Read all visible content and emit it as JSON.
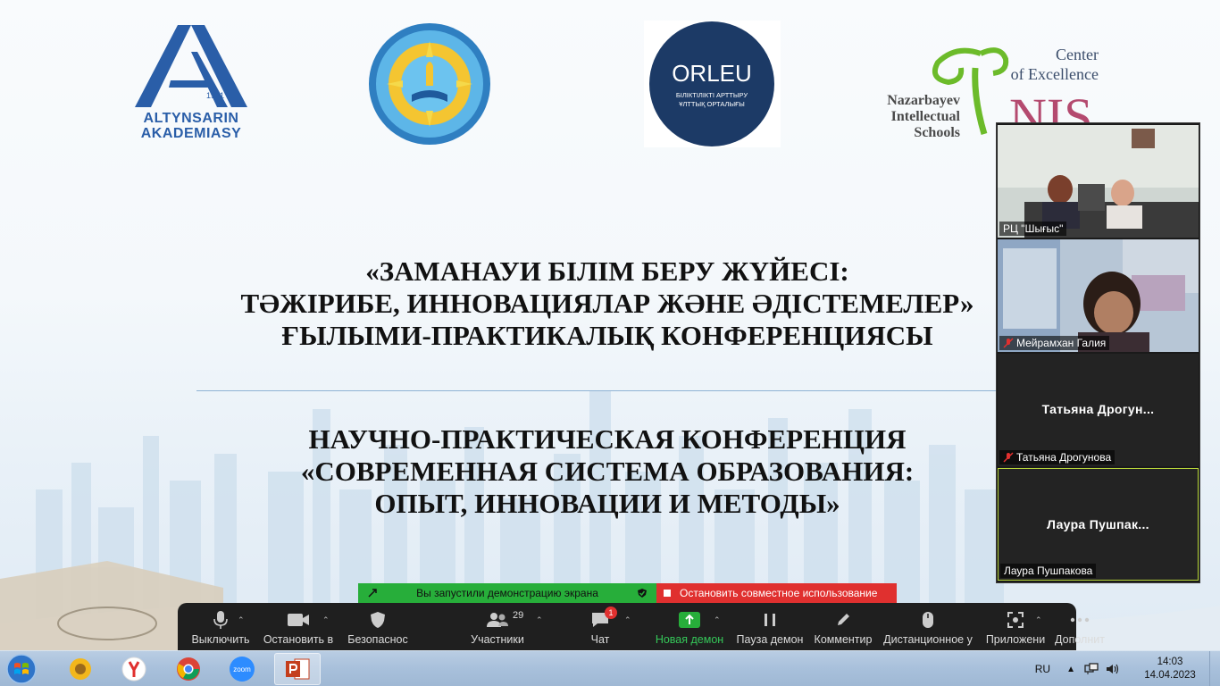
{
  "slide": {
    "logos": {
      "altynsarin": {
        "year": "1921",
        "line1": "ALTYNSARIN",
        "line2": "AKADEMIASY"
      },
      "orleu": {
        "name": "ORLEU",
        "sub1": "БІЛІКТІЛІКТІ АРТТЫРУ",
        "sub2": "ҰЛТТЫҚ ОРТАЛЫҒЫ"
      },
      "nis": {
        "center1": "Center",
        "center2": "of Excellence",
        "naz1": "Nazarbayev",
        "naz2": "Intellectual",
        "naz3": "Schools",
        "abbr": "NIS"
      }
    },
    "title_kz": [
      "«ЗАМАНАУИ БІЛІМ БЕРУ ЖҮЙЕСІ:",
      "ТӘЖІРИБЕ, ИННОВАЦИЯЛАР ЖӘНЕ ӘДІСТЕМЕЛЕР»",
      "ҒЫЛЫМИ-ПРАКТИКАЛЫҚ КОНФЕРЕНЦИЯСЫ"
    ],
    "title_ru": [
      "НАУЧНО-ПРАКТИЧЕСКАЯ КОНФЕРЕНЦИЯ",
      "«СОВРЕМЕННАЯ СИСТЕМА ОБРАЗОВАНИЯ:",
      "ОПЫТ, ИННОВАЦИИ И МЕТОДЫ»"
    ]
  },
  "participants": [
    {
      "name": "РЦ \"Шығыс\"",
      "muted": false,
      "video": true
    },
    {
      "name": "Мейрамхан Галия",
      "muted": true,
      "video": true
    },
    {
      "name": "Татьяна Дрогунова",
      "display": "Татьяна  Дрогун...",
      "muted": true,
      "video": false
    },
    {
      "name": "Лаура Пушпакова",
      "display": "Лаура  Пушпак...",
      "muted": false,
      "video": false,
      "active_speaker": true
    }
  ],
  "share_bar": {
    "status": "Вы запустили демонстрацию экрана",
    "stop": "Остановить совместное использование"
  },
  "toolbar": {
    "mute": "Выключить",
    "video": "Остановить в",
    "security": "Безопаснос",
    "participants": "Участники",
    "participants_count": "29",
    "chat": "Чат",
    "chat_badge": "1",
    "new_share": "Новая демон",
    "pause_share": "Пауза демон",
    "annotate": "Комментир",
    "remote": "Дистанционное у",
    "apps": "Приложени",
    "more": "Дополнит"
  },
  "taskbar": {
    "lang": "RU",
    "time": "14:03",
    "date": "14.04.2023",
    "apps": [
      "sunflower-app-icon",
      "yandex-browser-icon",
      "chrome-icon",
      "zoom-icon",
      "powerpoint-icon"
    ]
  },
  "colors": {
    "zoom_green": "#27ae3a",
    "stop_red": "#e0302f",
    "altyn_blue": "#2a5ea8",
    "orleu_navy": "#1c3a66",
    "nis_green": "#6cbb2a"
  }
}
